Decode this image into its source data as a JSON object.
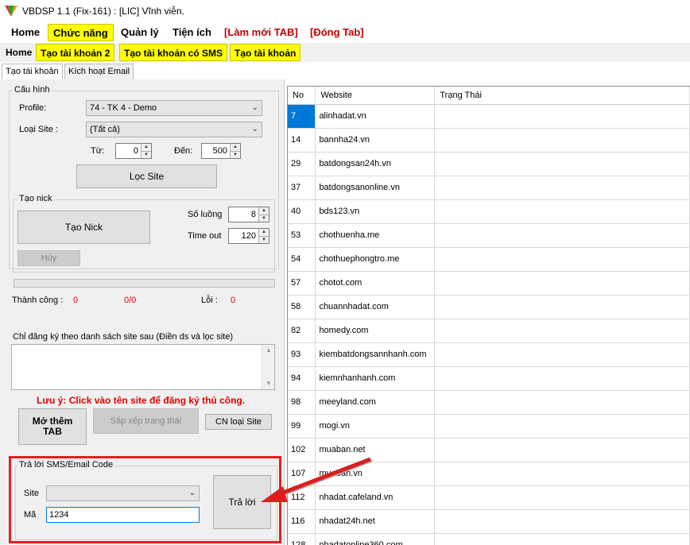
{
  "window": {
    "title": "VBDSP 1.1 (Fix-161) : [LIC] Vĩnh viễn."
  },
  "menu": {
    "home": "Home",
    "functions": "Chức năng",
    "manage": "Quản lý",
    "utilities": "Tiện ích",
    "refresh_tab": "[Làm mới TAB]",
    "close_tab": "[Đóng Tab]"
  },
  "subtabs": {
    "home": "Home",
    "create2": "Tạo tài khoản 2",
    "create_sms": "Tạo tài khoản có SMS",
    "create": "Tạo tài khoản"
  },
  "innertabs": {
    "create_account": "Tạo tài khoản",
    "activate_email": "Kích hoạt Email"
  },
  "config": {
    "group_label": "Cấu hình",
    "profile_label": "Profile:",
    "profile_value": "74 - TK 4 - Demo",
    "site_type_label": "Loại Site :",
    "site_type_value": "(Tất cả)",
    "from_label": "Từ:",
    "from_value": "0",
    "to_label": "Đến:",
    "to_value": "500",
    "filter_button": "Lọc Site"
  },
  "create_nick": {
    "group_label": "Tạo nick",
    "create_button": "Tạo Nick",
    "cancel_button": "Hủy",
    "count_label": "Số luồng",
    "count_value": "8",
    "timeout_label": "Time out",
    "timeout_value": "120"
  },
  "status": {
    "success_label": "Thành công :",
    "success_value": "0",
    "ratio_value": "0/0",
    "error_label": "Lỗi :",
    "error_value": "0"
  },
  "site_list": {
    "label": "Chỉ đăng ký theo danh sách site sau (Điền ds và lọc site)",
    "note": "Lưu ý: Click vào tên site để đăng ký thủ công.",
    "open_tab_button": "Mở thêm TAB",
    "sort_button": "Sắp xếp trạng thái",
    "update_button": "CN loại Site"
  },
  "reply": {
    "group_label": "Trả lời SMS/Email Code",
    "site_label": "Site",
    "site_value": "",
    "code_label": "Mã",
    "code_value": "1234",
    "reply_button": "Trả lời"
  },
  "table": {
    "headers": [
      "No",
      "Website",
      "Trạng Thái"
    ],
    "rows": [
      [
        "7",
        "alinhadat.vn",
        ""
      ],
      [
        "14",
        "bannha24.vn",
        ""
      ],
      [
        "29",
        "batdongsan24h.vn",
        ""
      ],
      [
        "37",
        "batdongsanonline.vn",
        ""
      ],
      [
        "40",
        "bds123.vn",
        ""
      ],
      [
        "53",
        "chothuenha.me",
        ""
      ],
      [
        "54",
        "chothuephongtro.me",
        ""
      ],
      [
        "57",
        "chotot.com",
        ""
      ],
      [
        "58",
        "chuannhadat.com",
        ""
      ],
      [
        "82",
        "homedy.com",
        ""
      ],
      [
        "93",
        "kiembatdongsannhanh.com",
        ""
      ],
      [
        "94",
        "kiemnhanhanh.com",
        ""
      ],
      [
        "98",
        "meeyland.com",
        ""
      ],
      [
        "99",
        "mogi.vn",
        ""
      ],
      [
        "102",
        "muaban.net",
        ""
      ],
      [
        "107",
        "muaban.vn",
        ""
      ],
      [
        "112",
        "nhadat.cafeland.vn",
        ""
      ],
      [
        "116",
        "nhadat24h.net",
        ""
      ],
      [
        "128",
        "nhadatonline360.com",
        ""
      ]
    ]
  },
  "colors": {
    "highlight_red": "#e02020",
    "menu_yellow": "#ffff00",
    "selection_blue": "#0078d7"
  }
}
